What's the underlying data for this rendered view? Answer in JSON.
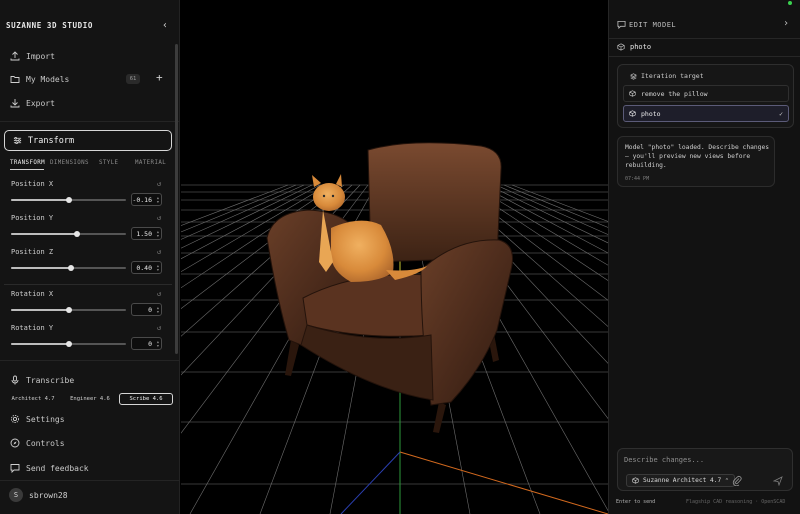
{
  "app": {
    "title": "SUZANNE 3D STUDIO",
    "collapse_icon": "chevron-left-icon"
  },
  "nav": {
    "import": "Import",
    "my_models": "My Models",
    "my_models_count": "61",
    "export": "Export",
    "transcribe": "Transcribe",
    "settings": "Settings",
    "controls": "Controls",
    "send_feedback": "Send feedback"
  },
  "transform": {
    "button_label": "Transform",
    "tabs": [
      "TRANSFORM",
      "DIMENSIONS",
      "STYLE",
      "MATERIAL"
    ],
    "active_tab": "TRANSFORM",
    "params": [
      {
        "label": "Position X",
        "value": "-0.16",
        "slider": 0.5
      },
      {
        "label": "Position Y",
        "value": "1.50",
        "slider": 0.57
      },
      {
        "label": "Position Z",
        "value": "0.40",
        "slider": 0.52
      },
      {
        "label": "Rotation X",
        "value": "0",
        "slider": 0.5
      },
      {
        "label": "Rotation Y",
        "value": "0",
        "slider": 0.5
      }
    ]
  },
  "transcribe_models": [
    "Architect 4.7",
    "Engineer 4.6",
    "Scribe 4.6"
  ],
  "transcribe_selected": "Scribe 4.6",
  "user": {
    "initial": "S",
    "name": "sbrown28"
  },
  "panel": {
    "title": "EDIT MODEL",
    "current_model": "photo",
    "iteration": {
      "title": "Iteration target",
      "options": [
        "remove the pillow",
        "photo"
      ],
      "selected": "photo"
    },
    "message": {
      "text": "Model \"photo\" loaded. Describe changes — you'll preview new views before rebuilding.",
      "time": "07:44 PM"
    },
    "compose": {
      "placeholder": "Describe changes...",
      "model": "Suzanne Architect 4.7"
    },
    "footer_left": "Enter to send",
    "footer_right": "Flagship CAD reasoning · OpenSCAD"
  },
  "colors": {
    "accent_green": "#3ad14f",
    "selected_border": "#5b5b78",
    "axis_x": "#d2691e",
    "axis_y": "#c8c832",
    "axis_z": "#2b3fb0",
    "axis_green": "#2e9a3c"
  }
}
